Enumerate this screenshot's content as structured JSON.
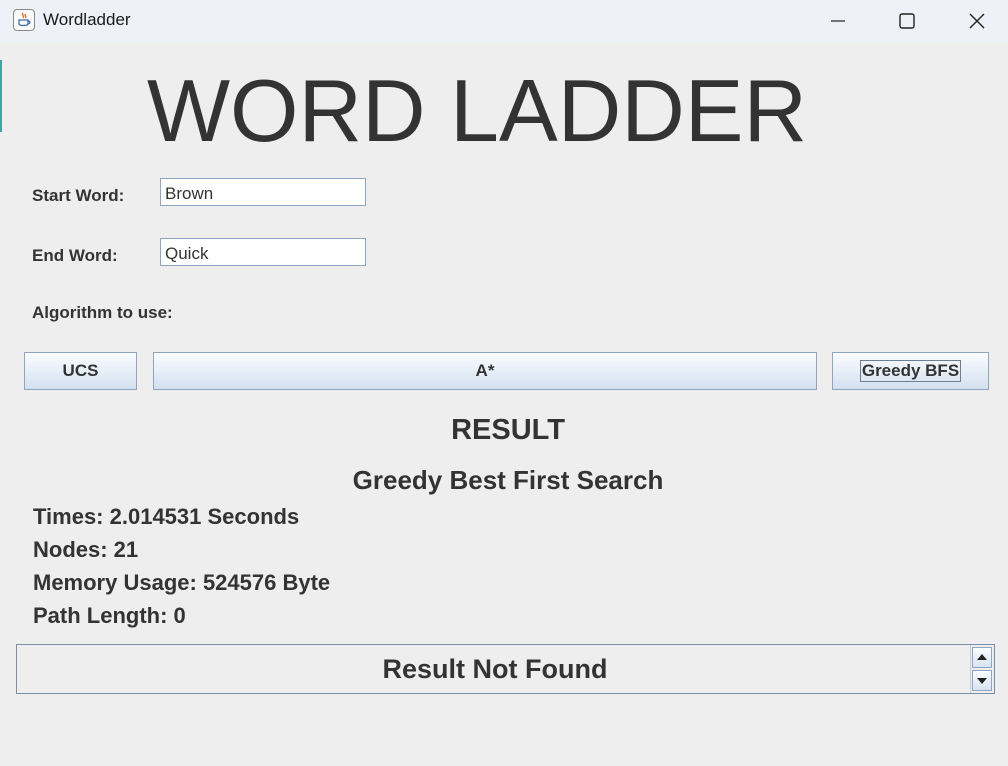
{
  "window": {
    "title": "Wordladder",
    "icons": {
      "app": "java-cup-icon",
      "minimize": "minimize-icon",
      "maximize": "maximize-icon",
      "close": "close-icon"
    }
  },
  "heading": "WORD LADDER",
  "form": {
    "start_label": "Start Word:",
    "start_value": "Brown",
    "end_label": "End Word:",
    "end_value": "Quick",
    "algorithm_label": "Algorithm to use:"
  },
  "buttons": {
    "ucs": "UCS",
    "astar": "A*",
    "greedy": "Greedy BFS"
  },
  "result": {
    "title": "RESULT",
    "algorithm": "Greedy Best First Search",
    "stats": [
      "Times: 2.014531 Seconds",
      "Nodes: 21",
      "Memory Usage: 524576 Byte",
      "Path Length: 0"
    ],
    "message": "Result Not Found"
  }
}
